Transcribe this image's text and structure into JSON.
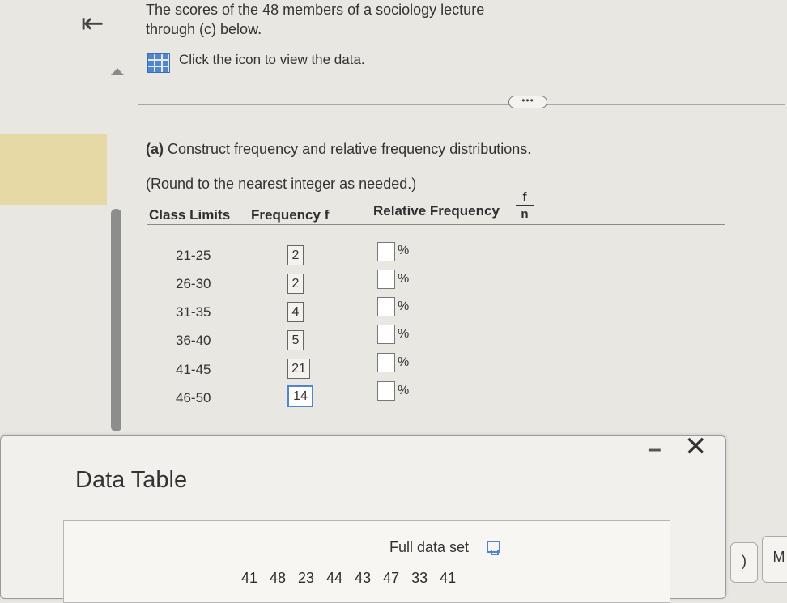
{
  "intro": {
    "line1": "The scores of the 48 members of a sociology lecture",
    "line2": "through (c) below."
  },
  "view_data_label": "Click the icon to view the data.",
  "more_button": "•••",
  "part_a": {
    "label": "(a)",
    "text": "Construct frequency and relative frequency distributions."
  },
  "round_note": "(Round to the nearest integer as needed.)",
  "table": {
    "headers": {
      "class_limits": "Class Limits",
      "frequency": "Frequency f",
      "relative": "Relative Frequency",
      "frac_num": "f",
      "frac_den": "n"
    },
    "rows": [
      {
        "class": "21-25",
        "freq": "2",
        "pct": "%"
      },
      {
        "class": "26-30",
        "freq": "2",
        "pct": "%"
      },
      {
        "class": "31-35",
        "freq": "4",
        "pct": "%"
      },
      {
        "class": "36-40",
        "freq": "5",
        "pct": "%"
      },
      {
        "class": "41-45",
        "freq": "21",
        "pct": "%"
      },
      {
        "class": "46-50",
        "freq": "14",
        "pct": "%"
      }
    ]
  },
  "popup": {
    "title": "Data Table",
    "minimize": "–",
    "close": "✕",
    "full_data": "Full data set",
    "values": "41 48 23 44 43 47 33 41"
  },
  "side_tabs": {
    "tab1": ")",
    "tab2": "M"
  }
}
